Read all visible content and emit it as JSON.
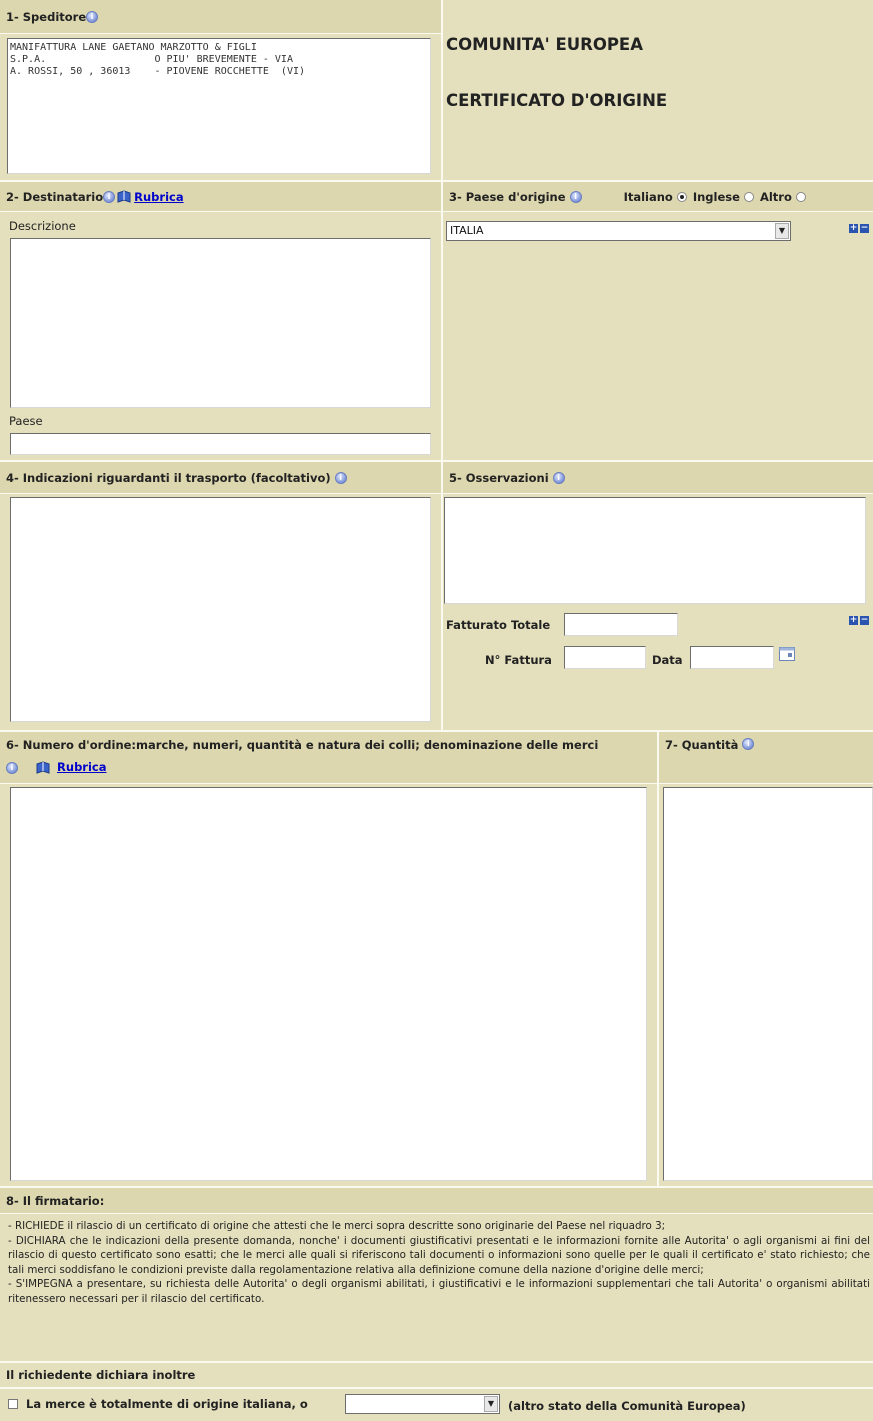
{
  "section1": {
    "title": "1- Speditore",
    "value": "MANIFATTURA LANE GAETANO MARZOTTO & FIGLI\nS.P.A.                  O PIU' BREVEMENTE - VIA\nA. ROSSI, 50 , 36013    - PIOVENE ROCCHETTE  (VI)"
  },
  "header_right": {
    "line1": "COMUNITA' EUROPEA",
    "line2": "CERTIFICATO D'ORIGINE"
  },
  "section2": {
    "title": "2- Destinatario",
    "link": "Rubrica",
    "desc_label": "Descrizione",
    "desc_value": "",
    "country_label": "Paese",
    "country_value": ""
  },
  "section3": {
    "title": "3- Paese d'origine",
    "lang_it": "Italiano",
    "lang_en": "Inglese",
    "lang_other": "Altro",
    "selected_lang": "Italiano",
    "country": "ITALIA"
  },
  "section4": {
    "title": "4- Indicazioni riguardanti il trasporto (facoltativo)",
    "value": ""
  },
  "section5": {
    "title": "5- Osservazioni",
    "value": "",
    "fatturato_label": "Fatturato Totale",
    "fattura_label": "N° Fattura",
    "data_label": "Data"
  },
  "section6": {
    "title": "6- Numero d'ordine:marche, numeri, quantità e natura dei colli; denominazione delle merci",
    "link": "Rubrica"
  },
  "section7": {
    "title": "7- Quantità"
  },
  "section8": {
    "title": "8- Il firmatario:",
    "p1": "- RICHIEDE il rilascio di un certificato di origine che attesti che le merci sopra descritte sono originarie del Paese nel riquadro 3;",
    "p2": "- DICHIARA che le indicazioni della presente domanda, nonche' i documenti giustificativi presentati e le informazioni fornite alle Autorita' o agli organismi ai fini del rilascio di questo certificato sono esatti; che le merci alle quali si riferiscono tali documenti o informazioni sono quelle per le quali il certificato e' stato richiesto; che tali merci soddisfano le condizioni previste dalla regolamentazione relativa alla definizione comune della nazione d'origine delle merci;",
    "p3": "- S'IMPEGNA a presentare, su richiesta delle Autorita' o degli organismi abilitati, i giustificativi e le informazioni supplementari che tali Autorita' o organismi abilitati ritenessero necessari per il rilascio del certificato."
  },
  "declaration": {
    "title": "Il richiedente dichiara inoltre",
    "check_label": "La merce è totalmente di origine italiana, o",
    "select_value": "",
    "suffix": "(altro stato della Comunità Europea)"
  },
  "colors": {
    "panel": "#e4e0bd",
    "header": "#dcd7ae",
    "link": "#0000cc"
  }
}
